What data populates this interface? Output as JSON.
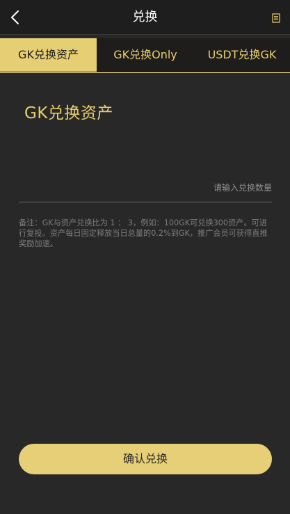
{
  "header": {
    "title": "兑换",
    "back_icon": "chevron-left-icon",
    "record_icon": "document-icon"
  },
  "tabs": [
    {
      "label": "GK兑换资产",
      "active": true
    },
    {
      "label": "GK兑换Only",
      "active": false
    },
    {
      "label": "USDT兑换GK",
      "active": false
    }
  ],
  "main": {
    "section_title": "GK兑换资产",
    "amount_input": {
      "value": "",
      "placeholder": "请输入兑换数量"
    },
    "note": "备注：GK与资产兑换比为 1 ： 3，例如：100GK可兑换300资产。可进行复投。资产每日固定释放当日总量的0.2%到GK，推广会员可获得直推奖励加速。",
    "confirm_label": "确认兑换"
  },
  "colors": {
    "background": "#292828",
    "header_bg": "#1f1e1e",
    "accent": "#e6ce74",
    "accent_text": "#e8ce6f",
    "note_text": "#7d7c7a"
  }
}
